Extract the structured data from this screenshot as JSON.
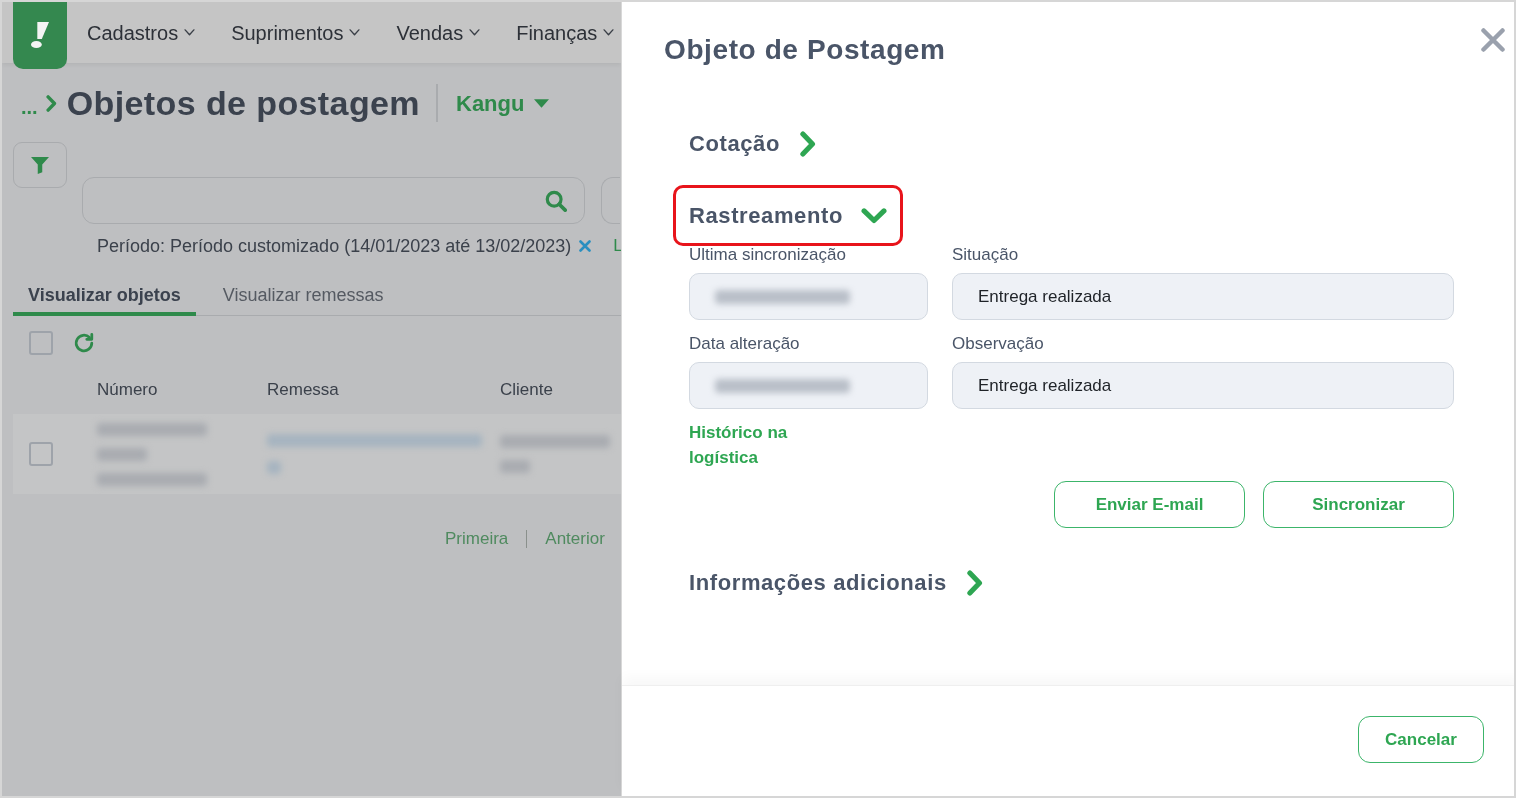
{
  "nav": {
    "items": [
      {
        "label": "Cadastros"
      },
      {
        "label": "Suprimentos"
      },
      {
        "label": "Vendas"
      },
      {
        "label": "Finanças"
      }
    ]
  },
  "breadcrumb": {
    "ellipsis": "...",
    "title": "Objetos de postagem",
    "account": "Kangu"
  },
  "filters": {
    "period": "Período: Período customizado (14/01/2023 até 13/02/2023)",
    "next_link": "L"
  },
  "tabs": [
    {
      "label": "Visualizar objetos",
      "selected": true
    },
    {
      "label": "Visualizar remessas",
      "selected": false
    }
  ],
  "table": {
    "select_all_checked": false,
    "columns": [
      "Número",
      "Remessa",
      "Cliente"
    ],
    "rows": [
      {
        "checked": false
      }
    ]
  },
  "pagination": [
    "Primeira",
    "Anterior"
  ],
  "modal": {
    "title": "Objeto de Postagem",
    "sections": [
      {
        "title": "Cotação",
        "expanded": false,
        "highlighted": false
      },
      {
        "title": "Rastreamento",
        "expanded": true,
        "highlighted": true,
        "fields": [
          {
            "label": "Ultima sincronização",
            "kind": "redacted"
          },
          {
            "label": "Situação",
            "kind": "text",
            "value": "Entrega realizada"
          },
          {
            "label": "Data alteração",
            "kind": "redacted"
          },
          {
            "label": "Observação",
            "kind": "text",
            "value": "Entrega realizada"
          }
        ],
        "link": "Histórico na logística",
        "buttons": [
          "Enviar E-mail",
          "Sincronizar"
        ]
      },
      {
        "title": "Informações adicionais",
        "expanded": false,
        "highlighted": false
      }
    ],
    "footer_buttons": [
      "Cancelar"
    ]
  }
}
